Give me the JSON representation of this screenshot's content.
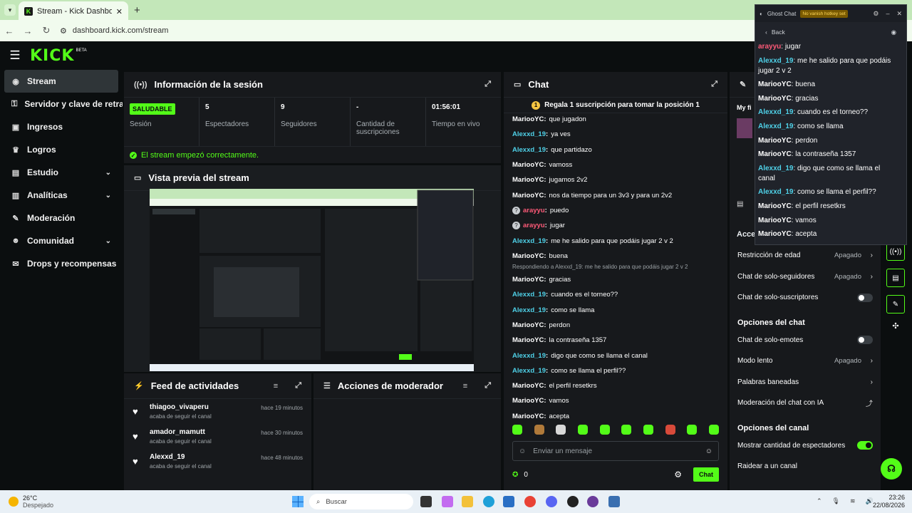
{
  "browser": {
    "tab_title": "Stream - Kick Dashboard",
    "tab_favicon": "K",
    "url": "dashboard.kick.com/stream"
  },
  "header": {
    "logo": "KICK",
    "beta": "BETA"
  },
  "sidebar": {
    "items": [
      {
        "label": "Stream",
        "icon": "broadcast-icon"
      },
      {
        "label": "Servidor y clave de retransmisión",
        "icon": "key-icon"
      },
      {
        "label": "Ingresos",
        "icon": "money-icon"
      },
      {
        "label": "Logros",
        "icon": "trophy-icon"
      },
      {
        "label": "Estudio",
        "icon": "studio-icon"
      },
      {
        "label": "Analíticas",
        "icon": "chart-icon"
      },
      {
        "label": "Moderación",
        "icon": "wrench-icon"
      },
      {
        "label": "Comunidad",
        "icon": "people-icon"
      },
      {
        "label": "Drops y recompensas",
        "icon": "gift-icon"
      }
    ]
  },
  "session": {
    "title": "Información de la sesión",
    "stats": [
      {
        "value": "SALUDABLE",
        "label": "Sesión"
      },
      {
        "value": "5",
        "label": "Espectadores"
      },
      {
        "value": "9",
        "label": "Seguidores"
      },
      {
        "value": "-",
        "label": "Cantidad de suscripciones"
      },
      {
        "value": "01:56:01",
        "label": "Tiempo en vivo"
      }
    ],
    "status_message": "El stream empezó correctamente."
  },
  "preview": {
    "title": "Vista previa del stream"
  },
  "feed": {
    "title": "Feed de actividades",
    "items": [
      {
        "name": "thiagoo_vivaperu",
        "sub": "acaba de seguir el canal",
        "time": "hace 19 minutos"
      },
      {
        "name": "amador_mamutt",
        "sub": "acaba de seguir el canal",
        "time": "hace 30 minutos"
      },
      {
        "name": "Alexxd_19",
        "sub": "acaba de seguir el canal",
        "time": "hace 48 minutos"
      }
    ]
  },
  "mod_actions": {
    "title": "Acciones de moderador"
  },
  "chat": {
    "title": "Chat",
    "pinned": "Regala 1 suscripción para tomar la posición 1",
    "messages": [
      {
        "user": "MariooYC",
        "text": "que jugadon",
        "color": "#ffffff"
      },
      {
        "user": "Alexxd_19",
        "text": "ya ves",
        "color": "#4fd1e8"
      },
      {
        "user": "Alexxd_19",
        "text": "que partidazo",
        "color": "#4fd1e8"
      },
      {
        "user": "MariooYC",
        "text": "vamoss",
        "color": "#ffffff"
      },
      {
        "user": "MariooYC",
        "text": "jugamos 2v2",
        "color": "#ffffff"
      },
      {
        "user": "MariooYC",
        "text": "nos da tiempo para un 3v3 y para un 2v2",
        "color": "#ffffff"
      },
      {
        "user": "arayyu",
        "text": "puedo",
        "color": "#ff5a78",
        "icon": true
      },
      {
        "user": "arayyu",
        "text": "jugar",
        "color": "#ff5a78",
        "icon": true
      },
      {
        "user": "Alexxd_19",
        "text": "me he salido para que podáis jugar 2 v 2",
        "color": "#4fd1e8"
      },
      {
        "user": "MariooYC",
        "text": "buena",
        "color": "#ffffff"
      },
      {
        "reply": "Respondiendo a Alexxd_19: me he salido para que podáis jugar 2 v 2",
        "user": "MariooYC",
        "text": "gracias",
        "color": "#ffffff"
      },
      {
        "user": "Alexxd_19",
        "text": "cuando es el torneo??",
        "color": "#4fd1e8"
      },
      {
        "user": "Alexxd_19",
        "text": "como se llama",
        "color": "#4fd1e8"
      },
      {
        "user": "MariooYC",
        "text": "perdon",
        "color": "#ffffff"
      },
      {
        "user": "MariooYC",
        "text": "la contraseña 1357",
        "color": "#ffffff"
      },
      {
        "user": "Alexxd_19",
        "text": "digo que como se llama el canal",
        "color": "#4fd1e8"
      },
      {
        "user": "Alexxd_19",
        "text": "como se llama el perfil??",
        "color": "#4fd1e8"
      },
      {
        "user": "MariooYC",
        "text": "el perfil resetkrs",
        "color": "#ffffff"
      },
      {
        "user": "MariooYC",
        "text": "vamos",
        "color": "#ffffff"
      },
      {
        "user": "MariooYC",
        "text": "acepta",
        "color": "#ffffff"
      }
    ],
    "input_placeholder": "Enviar un mensaje",
    "viewer_count": "0",
    "send_label": "Chat"
  },
  "modpanel": {
    "my_label": "My fi",
    "rows_top": [
      {
        "label": "Restricción de edad",
        "value": "Apagado",
        "kind": "chevron"
      },
      {
        "label": "Chat de solo-seguidores",
        "value": "Apagado",
        "kind": "chevron"
      },
      {
        "label": "Chat de solo-suscriptores",
        "value": "",
        "kind": "toggle",
        "on": false
      }
    ],
    "section_chat": "Opciones del chat",
    "rows_chat": [
      {
        "label": "Chat de solo-emotes",
        "value": "",
        "kind": "toggle",
        "on": false
      },
      {
        "label": "Modo lento",
        "value": "Apagado",
        "kind": "chevron"
      },
      {
        "label": "Palabras baneadas",
        "value": "",
        "kind": "chevron"
      },
      {
        "label": "Moderación del chat con IA",
        "value": "",
        "kind": "external"
      }
    ],
    "section_channel": "Opciones del canal",
    "rows_channel": [
      {
        "label": "Mostrar cantidad de espectadores",
        "value": "",
        "kind": "toggle",
        "on": true
      },
      {
        "label": "Raidear a un canal",
        "value": "",
        "kind": "none"
      }
    ],
    "acc_label": "Acce"
  },
  "ghost": {
    "title": "Ghost Chat",
    "badge": "No vanish hotkey set",
    "back": "Back",
    "messages": [
      {
        "user": "arayyu",
        "text": "jugar",
        "color": "#ff5a78"
      },
      {
        "user": "Alexxd_19",
        "text": "me he salido para que podáis jugar 2 v 2",
        "color": "#4fd1e8"
      },
      {
        "user": "MariooYC",
        "text": "buena",
        "color": "#ffffff"
      },
      {
        "user": "MariooYC",
        "text": "gracias",
        "color": "#ffffff"
      },
      {
        "user": "Alexxd_19",
        "text": "cuando es el torneo??",
        "color": "#4fd1e8"
      },
      {
        "user": "Alexxd_19",
        "text": "como se llama",
        "color": "#4fd1e8"
      },
      {
        "user": "MariooYC",
        "text": "perdon",
        "color": "#ffffff"
      },
      {
        "user": "MariooYC",
        "text": "la contraseña 1357",
        "color": "#ffffff"
      },
      {
        "user": "Alexxd_19",
        "text": "digo que como se llama el canal",
        "color": "#4fd1e8"
      },
      {
        "user": "Alexxd_19",
        "text": "como se llama el perfil??",
        "color": "#4fd1e8"
      },
      {
        "user": "MariooYC",
        "text": "el perfil resetkrs",
        "color": "#ffffff"
      },
      {
        "user": "MariooYC",
        "text": "vamos",
        "color": "#ffffff"
      },
      {
        "user": "MariooYC",
        "text": "acepta",
        "color": "#ffffff"
      }
    ]
  },
  "taskbar": {
    "temp": "26°C",
    "weather": "Despejado",
    "search": "Buscar",
    "time": "23:26",
    "date": "22/08/2026"
  },
  "colors": {
    "accent": "#53fc18",
    "panel": "#17191c",
    "bg": "#0b0e0f"
  }
}
